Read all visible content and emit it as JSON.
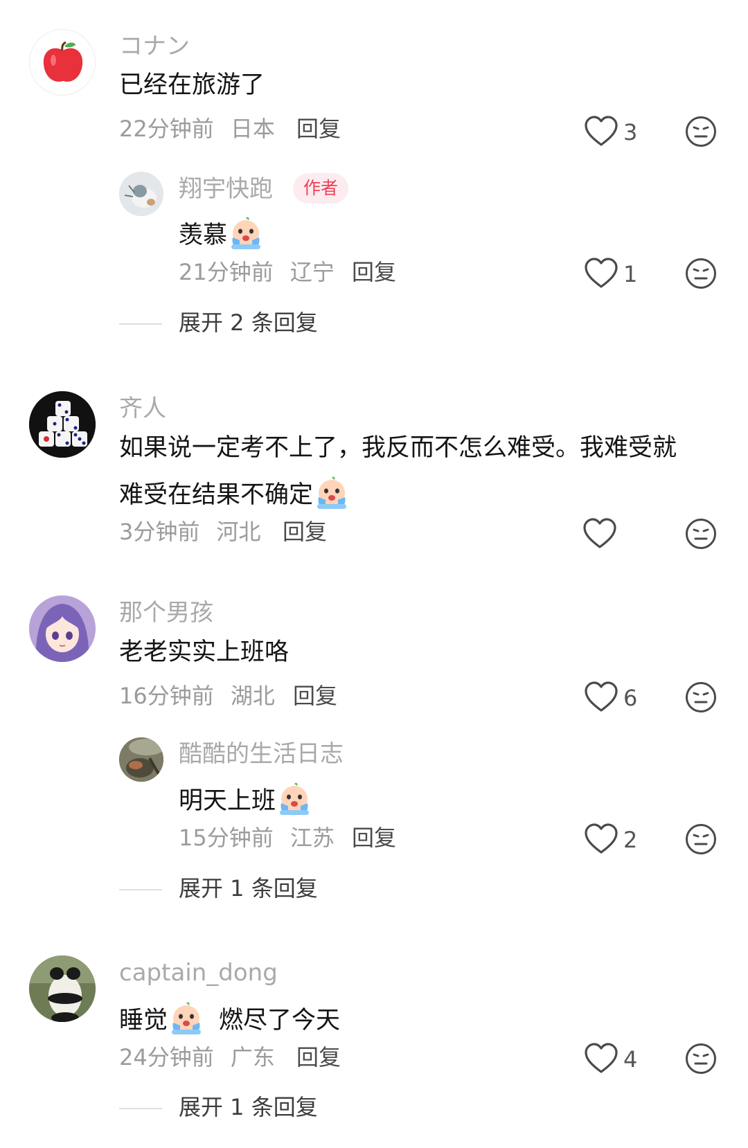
{
  "comments": [
    {
      "username": "コナン",
      "text": "已经在旅游了",
      "time": "22分钟前",
      "location": "日本",
      "reply_label": "回复",
      "likes": "3",
      "avatar": "apple-avatar",
      "replies": [
        {
          "username": "翔宇快跑",
          "author_tag": "作者",
          "text": "羡慕",
          "emoji": "crying-face-emoji",
          "time": "21分钟前",
          "location": "辽宁",
          "reply_label": "回复",
          "likes": "1"
        }
      ],
      "expand_label": "展开 2 条回复"
    },
    {
      "username": "齐人",
      "text_line1": "如果说一定考不上了，我反而不怎么难受。我难受就",
      "text_line2": "难受在结果不确定",
      "emoji": "crying-face-emoji",
      "time": "3分钟前",
      "location": "河北",
      "reply_label": "回复",
      "likes": "",
      "avatar": "dice-avatar"
    },
    {
      "username": "那个男孩",
      "text": "老老实实上班咯",
      "time": "16分钟前",
      "location": "湖北",
      "reply_label": "回复",
      "likes": "6",
      "avatar": "anime-girl-avatar",
      "replies": [
        {
          "username": "酷酷的生活日志",
          "text": "明天上班",
          "emoji": "crying-face-emoji",
          "time": "15分钟前",
          "location": "江苏",
          "reply_label": "回复",
          "likes": "2"
        }
      ],
      "expand_label": "展开 1 条回复"
    },
    {
      "username": "captain_dong",
      "text_before": "睡觉",
      "emoji": "crying-face-emoji",
      "text_after": "燃尽了今天",
      "time": "24分钟前",
      "location": "广东",
      "reply_label": "回复",
      "likes": "4",
      "avatar": "panda-avatar",
      "expand_label": "展开 1 条回复"
    }
  ],
  "colors": {
    "username": "#a9a9a9",
    "content": "#141414",
    "meta": "#9b9b9b",
    "author_tag_bg": "#fdecef",
    "author_tag_text": "#ef3f57"
  },
  "icons": {
    "like": "heart-outline-icon",
    "dislike": "neutral-face-icon"
  }
}
